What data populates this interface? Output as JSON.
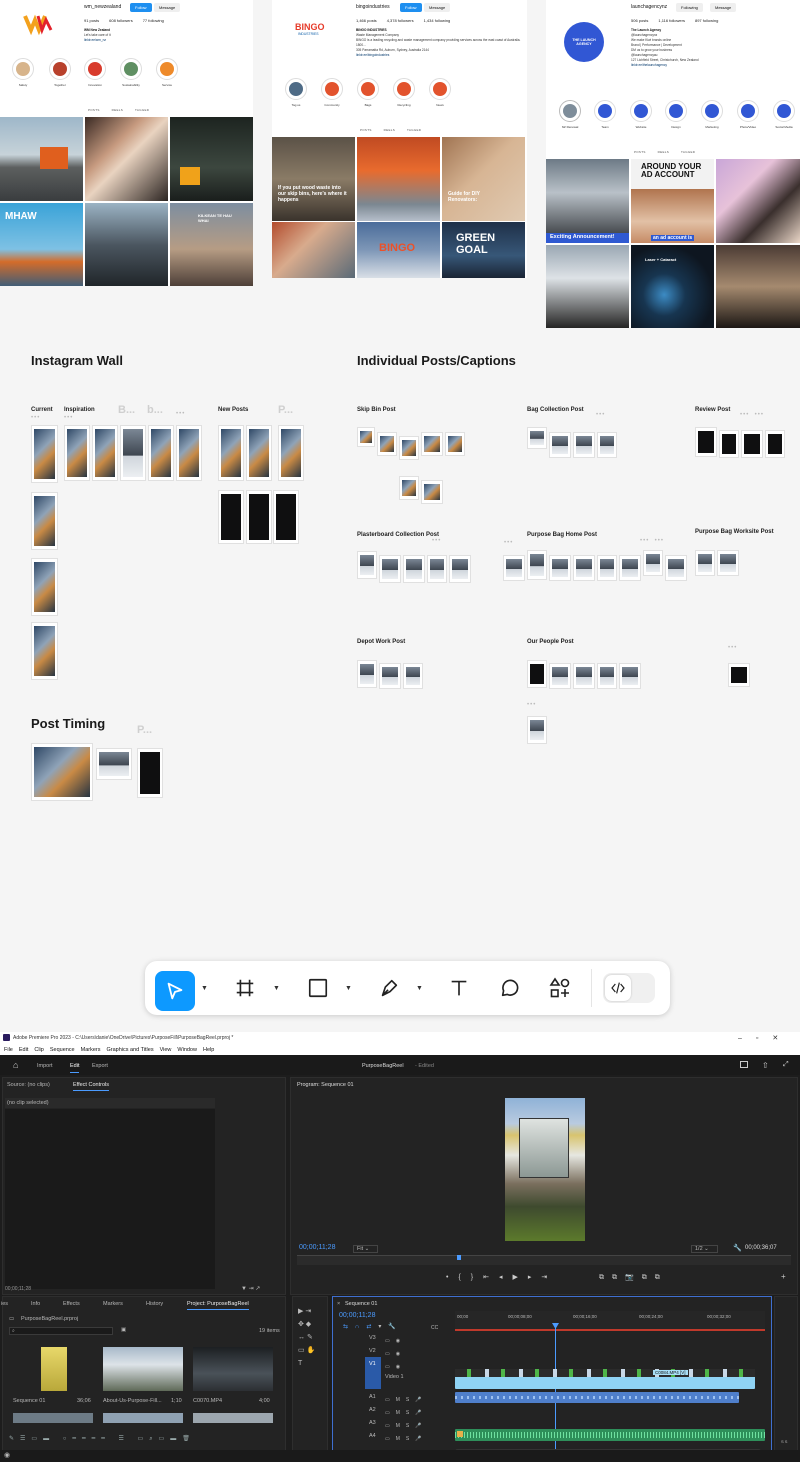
{
  "instagram": [
    {
      "username": "wm_newzealand",
      "follow_label": "Follow",
      "message_label": "Message",
      "stats": {
        "posts": "91 posts",
        "followers": "608 followers",
        "following": "77 following"
      },
      "bio_name": "WM New Zealand",
      "bio_lines": [
        "Let's take care of it",
        "linktr.ee/wm_nz"
      ],
      "highlights": [
        "Safety",
        "Together",
        "Innovation",
        "Sustainability",
        "Service"
      ],
      "tabs": [
        "POSTS",
        "REELS",
        "TAGGED"
      ],
      "tile_texts": [
        "MHAW",
        "KILKEAN TE HAU WHAI"
      ]
    },
    {
      "username": "bingoindustries",
      "follow_label": "Follow",
      "message_label": "Message",
      "stats": {
        "posts": "1,466 posts",
        "followers": "4,378 followers",
        "following": "1,434 following"
      },
      "bio_name": "BINGO INDUSTRIES",
      "bio_lines": [
        "Waste Management Company",
        "BINGO is a leading recycling and waste management company providing services across the east coast of Australia.",
        "1800...",
        "305 Parramatta Rd, Auburn, Sydney, Australia 2144",
        "linktr.ee/bingoindustries"
      ],
      "highlights": [
        "Tag us",
        "Community",
        "Bags",
        "Recycling",
        "News"
      ],
      "tabs": [
        "POSTS",
        "REELS",
        "TAGGED"
      ],
      "tile_texts": [
        "If you put wood waste into our skip bins, here's where it happens",
        "Guide for DIY Renovators:",
        "GREEN GOAL",
        "BINGO"
      ]
    },
    {
      "username": "launchagencynz",
      "follow_label": "Following",
      "message_label": "Message",
      "stats": {
        "posts": "506 posts",
        "followers": "1,116 followers",
        "following": "897 following"
      },
      "bio_name": "The Launch Agency",
      "bio_lines": [
        "@launchagencynz",
        "We make Kiwi brands online",
        "Brand | Performance | Development",
        "DM us to grow your business",
        "@launchagencyau",
        "127 Lichfield Street, Christchurch, New Zealand",
        "linktr.ee/thelaunchagency"
      ],
      "logo_text": "THE LAUNCH AGENCY",
      "highlights": [
        "NZ Renewal",
        "Team",
        "Website",
        "Design",
        "Marketing",
        "Photo/Video",
        "Social Media"
      ],
      "tabs": [
        "POSTS",
        "REELS",
        "TAGGED"
      ],
      "tile_texts": [
        "AROUND YOUR AD ACCOUNT",
        "Exciting Announcement!",
        "an ad account is",
        "Laser + Cataract"
      ]
    }
  ],
  "figma": {
    "sections": {
      "wall": "Instagram Wall",
      "posts": "Individual Posts/Captions",
      "timing": "Post Timing"
    },
    "wall_labels": [
      "Current",
      "Inspiration",
      "New Posts"
    ],
    "wall_ghost_labels": [
      "B...",
      "b...",
      "P..."
    ],
    "post_labels": [
      "Skip Bin Post",
      "Bag Collection Post",
      "Review Post",
      "Plasterboard Collection  Post",
      "Purpose Bag Home Post",
      "Purpose Bag Worksite Post",
      "Depot Work Post",
      "Our People Post"
    ],
    "timing_ghost": "P..."
  },
  "toolbar": {
    "tools": [
      "move-tool",
      "frame-tool",
      "shape-tool",
      "pen-tool",
      "text-tool",
      "comment-tool",
      "actions-tool",
      "dev-mode-toggle"
    ]
  },
  "premiere": {
    "title": "Adobe Premiere Pro 2023 - C:\\Users\\danie\\OneDrive\\Pictures\\PurposeFill\\PurposeBagReel.prproj *",
    "menu": [
      "File",
      "Edit",
      "Clip",
      "Sequence",
      "Markers",
      "Graphics and Titles",
      "View",
      "Window",
      "Help"
    ],
    "workspace_tabs": [
      "Import",
      "Edit",
      "Export"
    ],
    "project_name": "PurposeBagReel",
    "edited": "- Edited",
    "source_tab": "Source: (no clips)",
    "effect_controls": "Effect Controls",
    "no_clip": "(no clip selected)",
    "source_timecode": "00;00;11;28",
    "program_tab": "Program: Sequence 01",
    "program_timecode": "00;00;11;28",
    "fit": "Fit",
    "resolution": "1/2",
    "duration": "00;00;36;07",
    "project_tabs": [
      "ies",
      "Info",
      "Effects",
      "Markers",
      "History",
      "Project: PurposeBagReel"
    ],
    "project_file": "PurposeBagReel.prproj",
    "item_count": "19 items",
    "bin_items": [
      {
        "name": "Sequence 01",
        "dur": "36;06"
      },
      {
        "name": "About-Us-Purpose-Fill...",
        "dur": "1;10"
      },
      {
        "name": "C0070.MP4",
        "dur": "4;00"
      }
    ],
    "sequence_tab": "Sequence 01",
    "timeline_timecode": "00;00;11;28",
    "ruler": [
      "00;00",
      "00;00;08;00",
      "00;00;16;00",
      "00;00;24;00",
      "00;00;32;00"
    ],
    "video_tracks": [
      "V3",
      "V2",
      "V1"
    ],
    "audio_tracks": [
      "A1",
      "A2",
      "A3",
      "A4"
    ],
    "v1_name": "Video 1",
    "clip_label": "C0084.MP4 [V]"
  }
}
